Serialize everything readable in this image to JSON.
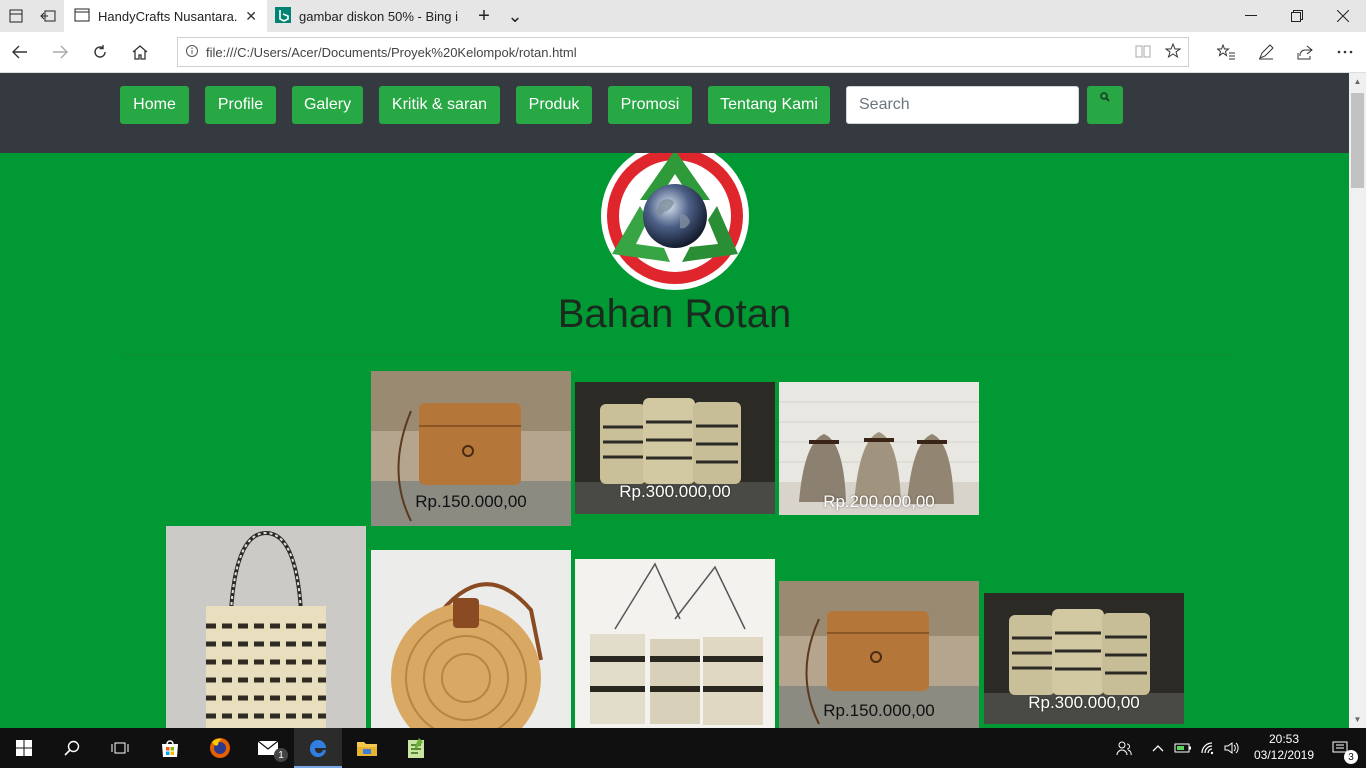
{
  "browser": {
    "tabs": [
      {
        "label": "HandyCrafts Nusantara.",
        "active": true
      },
      {
        "label": "gambar diskon 50% - Bing i",
        "active": false
      }
    ],
    "url": "file:///C:/Users/Acer/Documents/Proyek%20Kelompok/rotan.html",
    "new_tab_glyph": "+",
    "tab_list_glyph": "⌄",
    "close_tab_glyph": "✕"
  },
  "site": {
    "nav": [
      "Home",
      "Profile",
      "Galery",
      "Kritik & saran",
      "Produk",
      "Promosi",
      "Tentang Kami"
    ],
    "search_placeholder": "Search",
    "title": "Bahan Rotan",
    "products": [
      {
        "price": "Rp.150.000,00",
        "image": "square-rattan-bag"
      },
      {
        "price": "Rp.300.000,00",
        "image": "woven-bucket-bags"
      },
      {
        "price": "Rp.200.000,00",
        "image": "drawstring-bucket-bags"
      },
      {
        "price": "",
        "image": "woven-tote-bag"
      },
      {
        "price": "",
        "image": "round-rattan-bag"
      },
      {
        "price": "",
        "image": "woven-slings"
      },
      {
        "price": "Rp.150.000,00",
        "image": "square-rattan-bag"
      },
      {
        "price": "Rp.300.000,00",
        "image": "woven-bucket-bags"
      }
    ]
  },
  "taskbar": {
    "clock_time": "20:53",
    "clock_date": "03/12/2019",
    "mail_badge": "1",
    "notification_badge": "3"
  },
  "colors": {
    "page_green": "#009933",
    "button_green": "#28a745",
    "nav_dark": "#343a40"
  }
}
